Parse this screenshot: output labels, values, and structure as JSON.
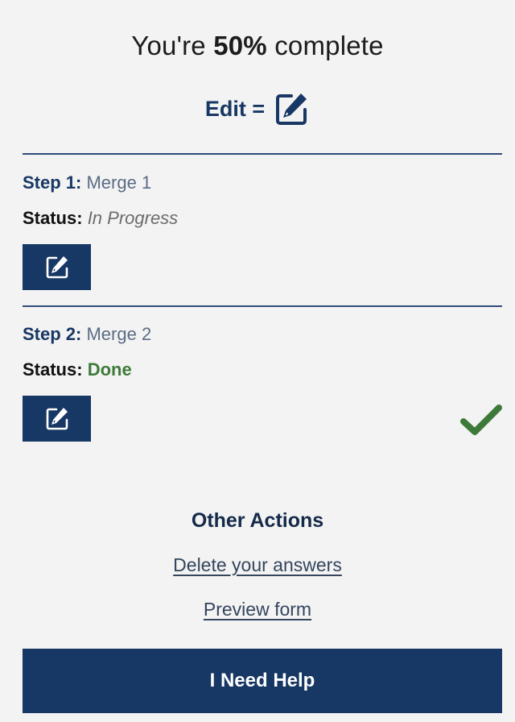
{
  "progress": {
    "prefix": "You're ",
    "percent": "50%",
    "suffix": " complete"
  },
  "legend": {
    "label": "Edit =",
    "icon": "edit-pencil-icon"
  },
  "steps": [
    {
      "label": "Step  1:",
      "name": "Merge 1",
      "status_label": "Status:",
      "status_value": "In Progress",
      "edit_icon": "edit-pencil-icon"
    },
    {
      "label": "Step  2:",
      "name": "Merge 2",
      "status_label": "Status:",
      "status_value": "Done",
      "edit_icon": "edit-pencil-icon",
      "complete_icon": "checkmark-icon"
    }
  ],
  "other_actions": {
    "title": "Other Actions",
    "links": [
      "Delete your answers",
      "Preview form"
    ]
  },
  "help_button": "I Need Help",
  "colors": {
    "primary": "#173764",
    "done": "#3d7a3a",
    "background": "#f3f3f3"
  }
}
